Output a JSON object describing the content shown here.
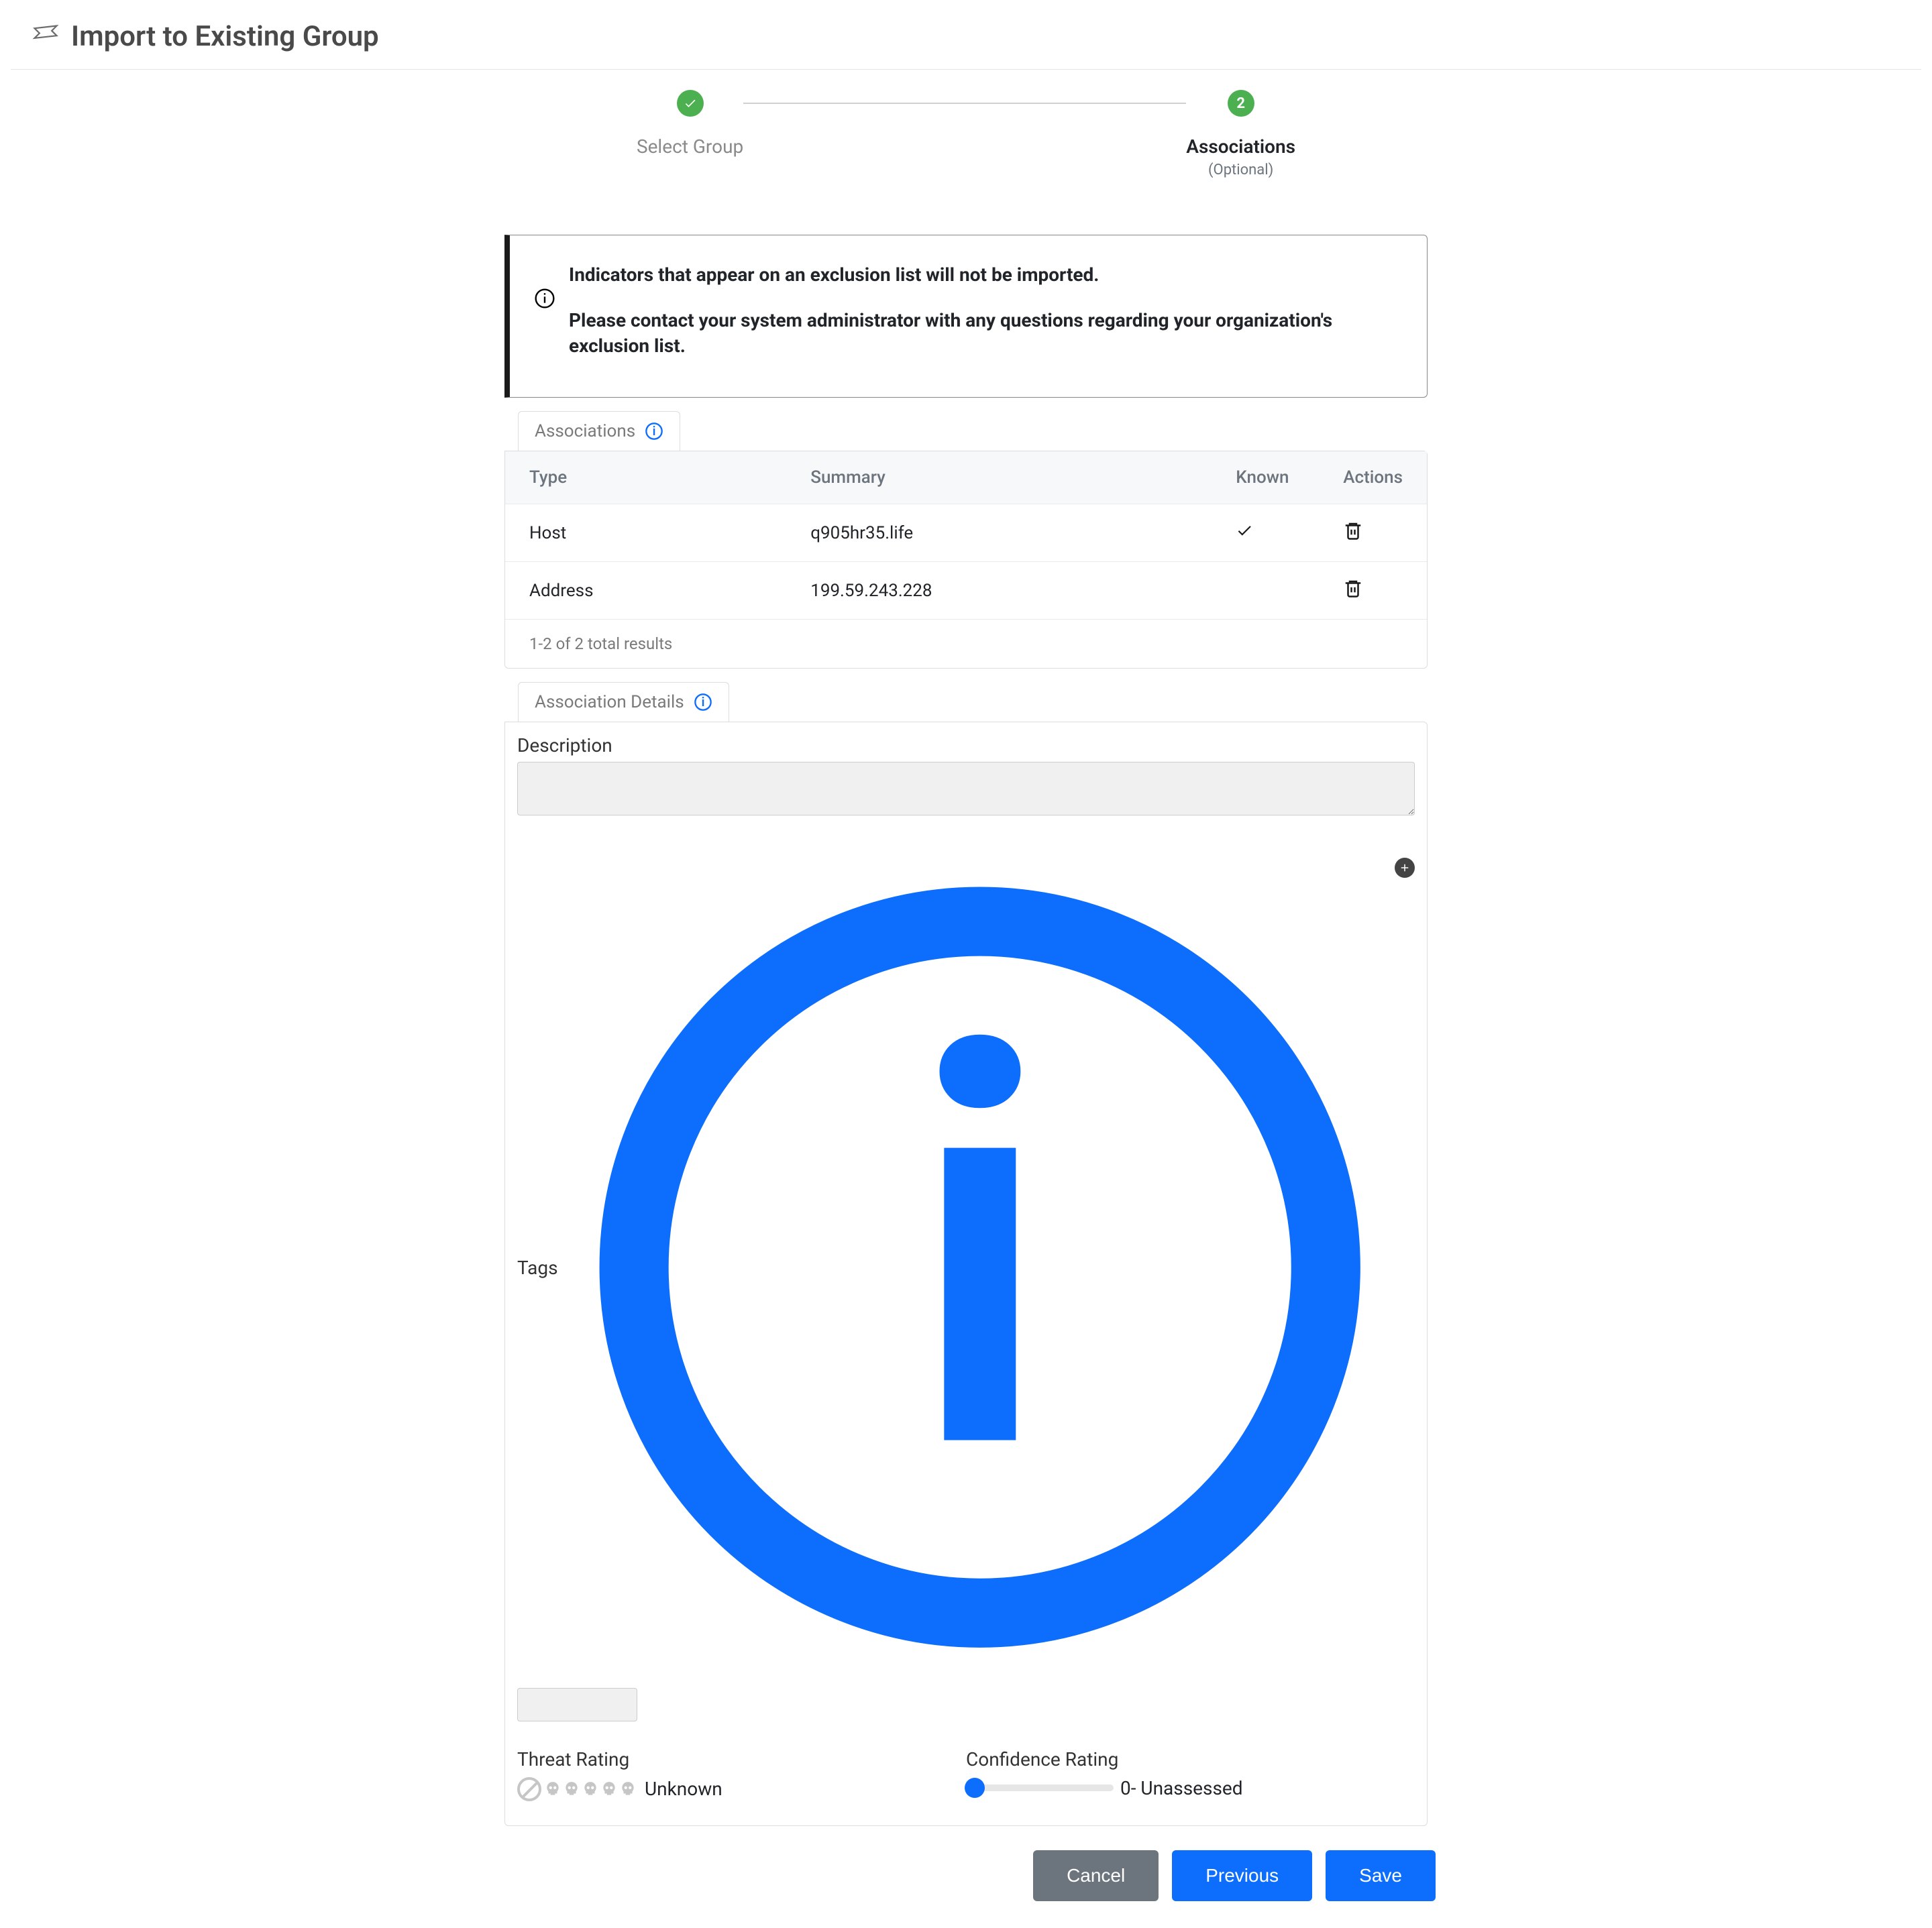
{
  "header": {
    "title": "Import to Existing Group"
  },
  "stepper": {
    "step1_label": "Select Group",
    "step2_label": "Associations",
    "step2_sub": "(Optional)",
    "step2_number": "2"
  },
  "info": {
    "line1": "Indicators that appear on an exclusion list will not be imported.",
    "line2": "Please contact your system administrator with any questions regarding your organization's exclusion list."
  },
  "tabs": {
    "associations": "Associations",
    "details": "Association Details"
  },
  "table": {
    "headers": {
      "type": "Type",
      "summary": "Summary",
      "known": "Known",
      "actions": "Actions"
    },
    "rows": [
      {
        "type": "Host",
        "summary": "q905hr35.life",
        "known": true
      },
      {
        "type": "Address",
        "summary": "199.59.243.228",
        "known": false
      }
    ],
    "footer": "1-2 of 2 total results"
  },
  "details": {
    "description_label": "Description",
    "tags_label": "Tags",
    "threat_label": "Threat Rating",
    "threat_value": "Unknown",
    "confidence_label": "Confidence Rating",
    "confidence_value": "0- Unassessed"
  },
  "buttons": {
    "cancel": "Cancel",
    "previous": "Previous",
    "save": "Save"
  }
}
